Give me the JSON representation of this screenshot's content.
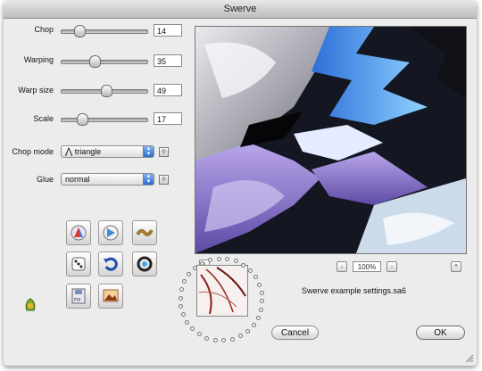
{
  "window": {
    "title": "Swerve"
  },
  "params": [
    {
      "label": "Chop",
      "value": "14",
      "fraction": 0.14
    },
    {
      "label": "Warping",
      "value": "35",
      "fraction": 0.35
    },
    {
      "label": "Warp size",
      "value": "49",
      "fraction": 0.49
    },
    {
      "label": "Scale",
      "value": "17",
      "fraction": 0.17
    }
  ],
  "chop_mode": {
    "label": "Chop mode",
    "value": "triangle",
    "glyph": "⋀"
  },
  "glue": {
    "label": "Glue",
    "value": "normal"
  },
  "tools": [
    {
      "name": "colorize-icon"
    },
    {
      "name": "render-icon"
    },
    {
      "name": "wave-icon"
    },
    {
      "name": "dice-icon"
    },
    {
      "name": "undo-icon"
    },
    {
      "name": "ring-icon"
    },
    {
      "name": "floppy-icon"
    },
    {
      "name": "picture-icon"
    }
  ],
  "preview": {
    "info_label": "i",
    "minus_label": "-",
    "zoom": "100%",
    "plus_label": "+",
    "up_label": "^"
  },
  "settings_file": "Swerve example settings.sa6",
  "buttons": {
    "cancel": "Cancel",
    "ok": "OK"
  },
  "colors": {
    "accent": "#2b6ad2"
  }
}
